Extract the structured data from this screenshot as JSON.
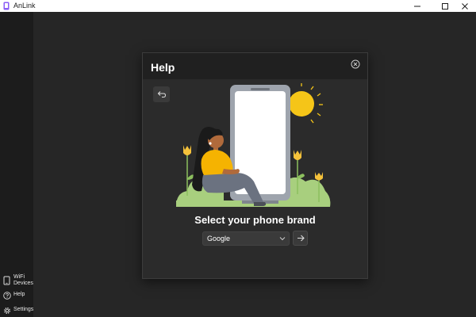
{
  "app": {
    "title": "AnLink",
    "icon": "phone-app-icon"
  },
  "window_controls": [
    "minimize-icon",
    "maximize-icon",
    "close-icon"
  ],
  "sidebar": {
    "items": [
      {
        "label": "WiFi\nDevices",
        "icon": "phone-wifi-icon"
      },
      {
        "label": "Help",
        "icon": "help-circle-icon"
      },
      {
        "label": "Settings",
        "icon": "gear-icon"
      }
    ]
  },
  "dialog": {
    "title": "Help",
    "close_icon": "close-circle-icon",
    "back_icon": "return-arrow-icon",
    "illustration": "woman-sitting-by-phone-illustration",
    "prompt": "Select your phone brand",
    "brand_select": {
      "value": "Google"
    },
    "next_icon": "arrow-right-icon"
  },
  "colors": {
    "titlebar": "#ffffff",
    "sidebar": "#1c1c1c",
    "main_background": "#262626",
    "dialog_body": "#2b2b2b",
    "dialog_header": "#202020",
    "control": "#3a3a3a",
    "sun": "#f5c518",
    "shirt": "#f5b301",
    "foliage": "#a8cf7e"
  }
}
